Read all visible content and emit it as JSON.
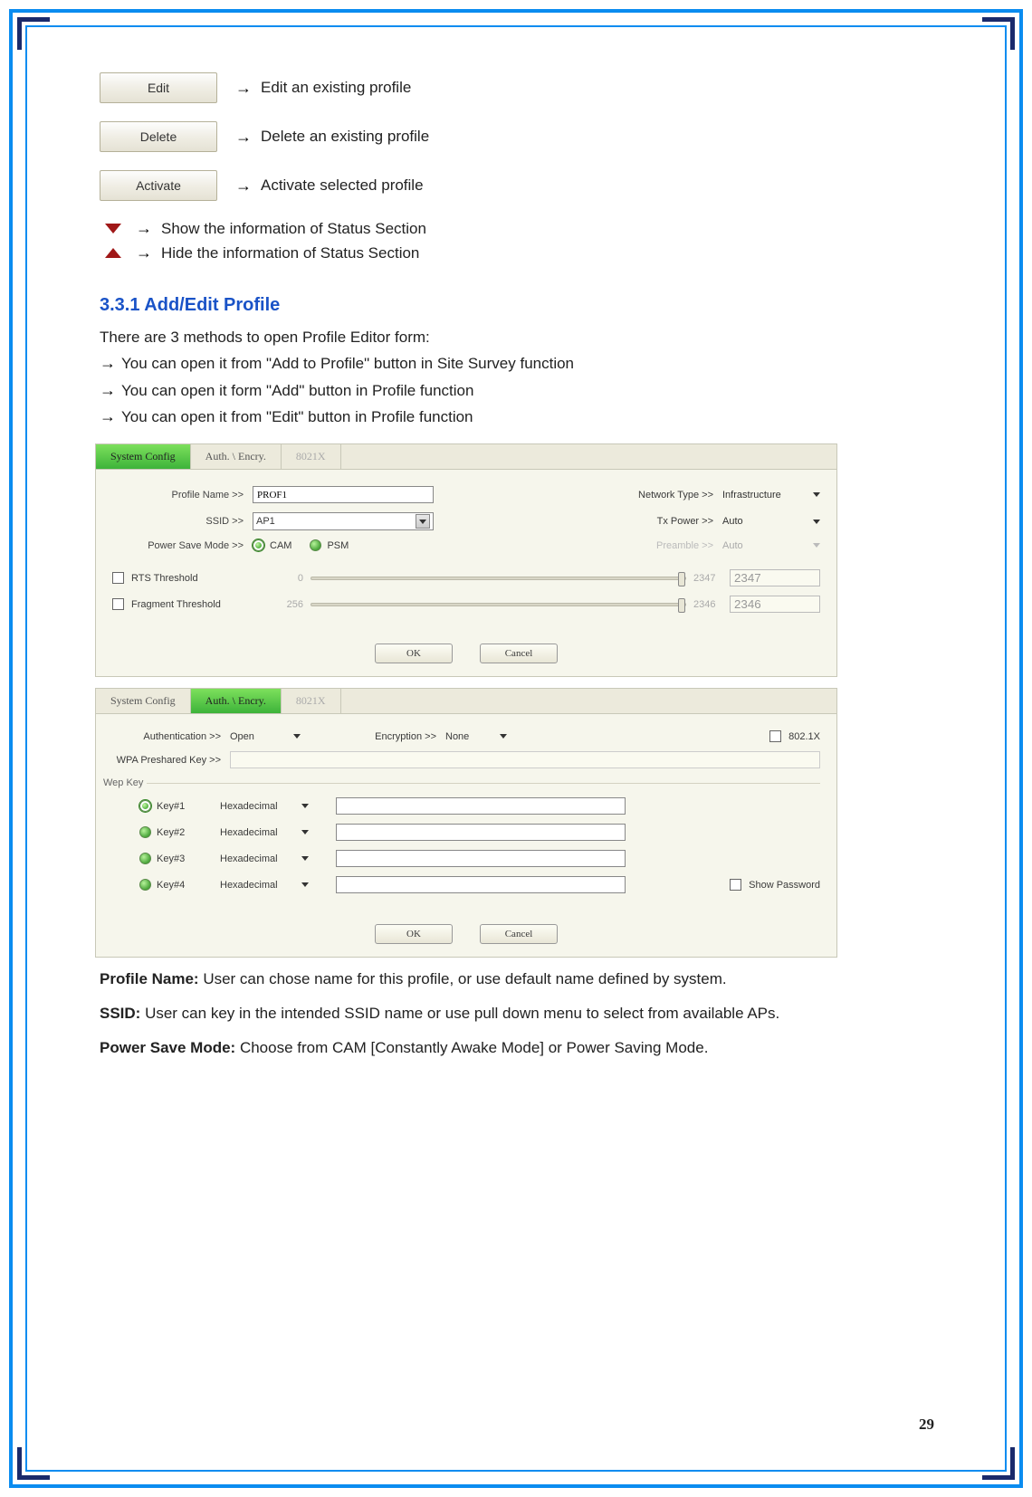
{
  "buttons": {
    "edit": "Edit",
    "delete": "Delete",
    "activate": "Activate",
    "edit_desc": "Edit an existing profile",
    "delete_desc": "Delete an existing profile",
    "activate_desc": "Activate selected profile",
    "show_desc": "Show the information of Status Section",
    "hide_desc": "Hide the information of Status Section"
  },
  "section_heading": "3.3.1 Add/Edit Profile",
  "intro": "There are 3 methods to open Profile Editor form:",
  "methods": [
    "You can open it from \"Add to Profile\" button in Site Survey function",
    "You can open it form \"Add\" button in Profile function",
    "You can open it from \"Edit\" button in Profile function"
  ],
  "dialog1": {
    "tabs": {
      "t1": "System Config",
      "t2": "Auth. \\ Encry.",
      "t3": "8021X"
    },
    "labels": {
      "profile_name": "Profile Name >>",
      "ssid": "SSID >>",
      "power": "Power Save Mode >>",
      "net_type": "Network Type >>",
      "tx": "Tx Power >>",
      "pre": "Preamble >>",
      "rts": "RTS Threshold",
      "frag": "Fragment Threshold"
    },
    "values": {
      "profile_name": "PROF1",
      "ssid": "AP1",
      "cam": "CAM",
      "psm": "PSM",
      "net_type": "Infrastructure",
      "tx": "Auto",
      "pre": "Auto",
      "rts_min": "0",
      "rts_max": "2347",
      "rts_val": "2347",
      "frag_min": "256",
      "frag_max": "2346",
      "frag_val": "2346"
    },
    "ok": "OK",
    "cancel": "Cancel"
  },
  "dialog2": {
    "tabs": {
      "t1": "System Config",
      "t2": "Auth. \\ Encry.",
      "t3": "8021X"
    },
    "labels": {
      "auth": "Authentication >>",
      "enc": "Encryption >>",
      "x": "802.1X",
      "wpa": "WPA Preshared Key >>",
      "wep": "Wep Key",
      "k1": "Key#1",
      "k2": "Key#2",
      "k3": "Key#3",
      "k4": "Key#4",
      "hex": "Hexadecimal",
      "show": "Show Password"
    },
    "values": {
      "auth": "Open",
      "enc": "None"
    },
    "ok": "OK",
    "cancel": "Cancel"
  },
  "defs": {
    "profile": "Profile Name:",
    "profile_text": " User can chose name for this profile, or use default name defined by system.",
    "ssid": "SSID:",
    "ssid_text": " User can key in the intended SSID name or use pull down menu to select from available APs.",
    "power": "Power Save Mode:",
    "power_text": " Choose from CAM [Constantly Awake Mode] or Power Saving Mode."
  },
  "page": "29"
}
